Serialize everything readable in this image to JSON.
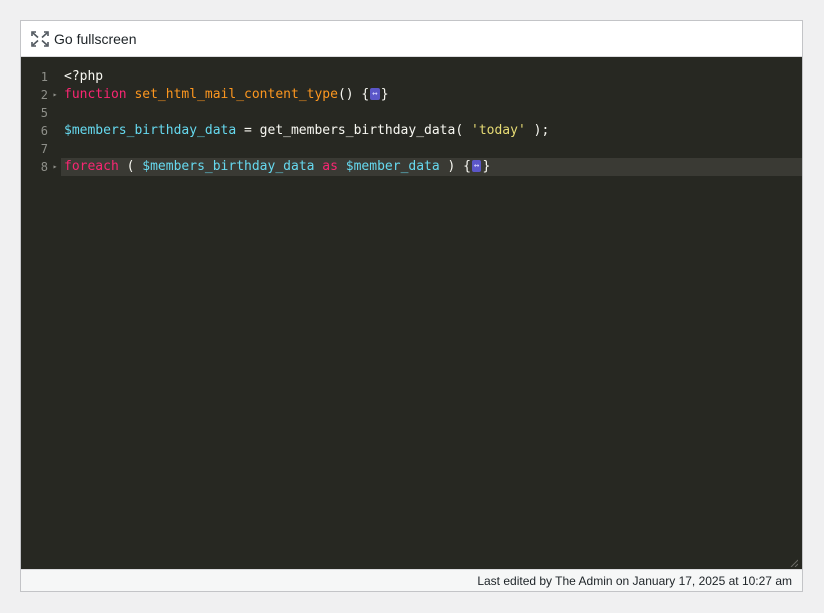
{
  "toolbar": {
    "fullscreen_label": "Go fullscreen",
    "fullscreen_icon": "fullscreen-icon"
  },
  "editor": {
    "theme_colors": {
      "background": "#272822",
      "keyword": "#f92672",
      "function_name": "#fd971f",
      "variable": "#66d9ef",
      "string": "#e6db74",
      "text": "#f8f8f2",
      "fold_widget": "#5b56c8"
    },
    "lines": [
      {
        "number": "1",
        "foldable": false,
        "tokens": [
          {
            "t": "<?php",
            "c": "plain"
          }
        ]
      },
      {
        "number": "2",
        "foldable": true,
        "tokens": [
          {
            "t": "function",
            "c": "kw"
          },
          {
            "t": " ",
            "c": "plain"
          },
          {
            "t": "set_html_mail_content_type",
            "c": "fname"
          },
          {
            "t": "() {",
            "c": "plain"
          },
          {
            "t": "↔",
            "c": "fold"
          },
          {
            "t": "}",
            "c": "plain"
          }
        ]
      },
      {
        "number": "5",
        "foldable": false,
        "tokens": []
      },
      {
        "number": "6",
        "foldable": false,
        "tokens": [
          {
            "t": "$members_birthday_data",
            "c": "var"
          },
          {
            "t": " = get_members_birthday_data( ",
            "c": "plain"
          },
          {
            "t": "'today'",
            "c": "str"
          },
          {
            "t": " );",
            "c": "plain"
          }
        ]
      },
      {
        "number": "7",
        "foldable": false,
        "tokens": []
      },
      {
        "number": "8",
        "foldable": true,
        "active": true,
        "tokens": [
          {
            "t": "foreach",
            "c": "kw"
          },
          {
            "t": " ( ",
            "c": "plain"
          },
          {
            "t": "$members_birthday_data",
            "c": "var"
          },
          {
            "t": " ",
            "c": "plain"
          },
          {
            "t": "as",
            "c": "kw"
          },
          {
            "t": " ",
            "c": "plain"
          },
          {
            "t": "$member_data",
            "c": "var"
          },
          {
            "t": " ) {",
            "c": "plain"
          },
          {
            "t": "↔",
            "c": "fold"
          },
          {
            "t": "}",
            "c": "plain"
          }
        ]
      }
    ]
  },
  "footer": {
    "last_edited": "Last edited by The Admin on January 17, 2025 at 10:27 am"
  }
}
